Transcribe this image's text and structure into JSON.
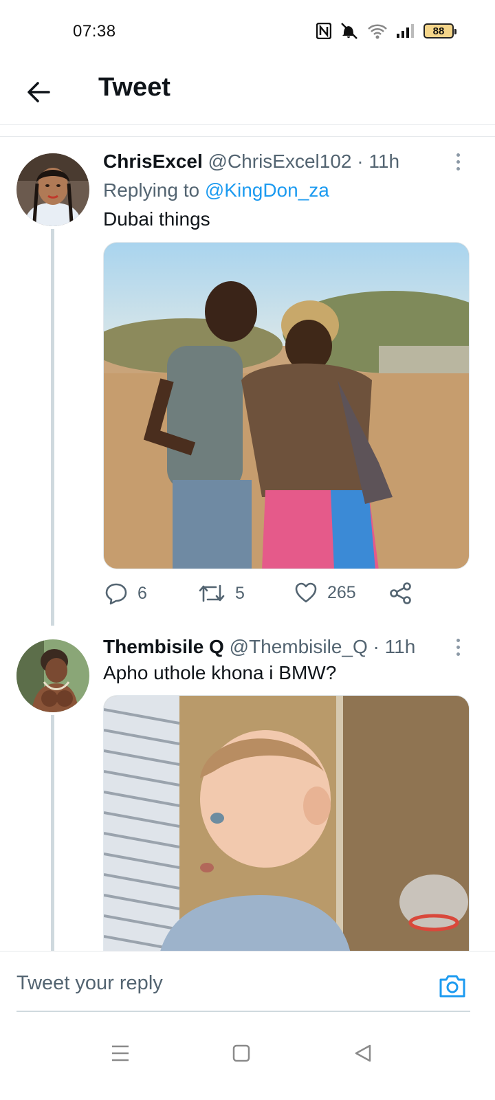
{
  "status_bar": {
    "time": "07:38",
    "battery": "88",
    "icons": [
      "nfc-icon",
      "mute-icon",
      "wifi-icon",
      "signal-icon",
      "battery-icon"
    ]
  },
  "header": {
    "back_icon": "arrow-left-icon",
    "title": "Tweet"
  },
  "tweets": [
    {
      "display_name": "ChrisExcel",
      "handle": "@ChrisExcel102",
      "separator": " · ",
      "time": "11h",
      "reply_prefix": "Replying to",
      "reply_to": "@KingDon_za",
      "text": "Dubai things",
      "media_description": "photo-man-and-woman-arguing",
      "actions": {
        "replies": "6",
        "retweets": "5",
        "likes": "265"
      }
    },
    {
      "display_name": "Thembisile Q",
      "handle": "@Thembisile_Q",
      "separator": " · ",
      "time": "11h",
      "text": "Apho uthole khona i BMW?",
      "media_description": "photo-toddler-by-window"
    }
  ],
  "reply_bar": {
    "placeholder": "Tweet your reply",
    "camera_icon": "camera-icon"
  },
  "nav_bar": {
    "icons": [
      "menu-icon",
      "home-square-icon",
      "back-triangle-icon"
    ]
  },
  "colors": {
    "accent": "#1d9bf0",
    "secondary_text": "#536471",
    "primary_text": "#0f1419",
    "divider": "#e6e9ec",
    "thread_line": "#cfd9de"
  }
}
